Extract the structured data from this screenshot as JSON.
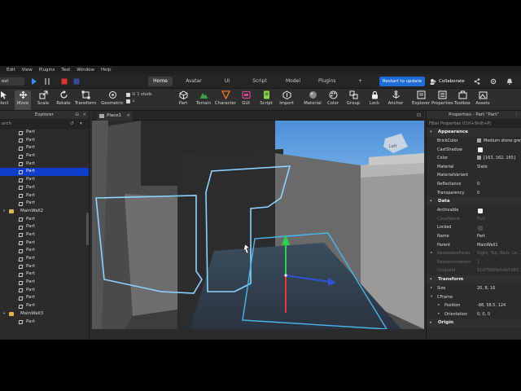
{
  "menu": [
    "Edit",
    "View",
    "Plugins",
    "Test",
    "Window",
    "Help"
  ],
  "test_mode": "est",
  "ribbon_tabs": [
    {
      "label": "Home",
      "active": true
    },
    {
      "label": "Avatar",
      "active": false
    },
    {
      "label": "UI",
      "active": false
    },
    {
      "label": "Script",
      "active": false
    },
    {
      "label": "Model",
      "active": false
    },
    {
      "label": "Plugins",
      "active": false
    },
    {
      "label": "+",
      "active": false
    }
  ],
  "restart_label": "Restart to update",
  "collaborate_label": "Collaborate",
  "toolbar": {
    "tools": [
      "elect",
      "Move",
      "Scale",
      "Rotate",
      "Transform"
    ],
    "geometric": "Geometric",
    "snap_studs": "1 studs",
    "snap_angle": "",
    "create": [
      "Part",
      "Terrain",
      "Character",
      "GUI",
      "Script",
      "Import"
    ],
    "format": [
      "Material",
      "Color",
      "Group",
      "Lock",
      "Anchor"
    ],
    "windows": [
      "Explorer",
      "Properties",
      "Toolbox",
      "Assets"
    ]
  },
  "explorer": {
    "title": "Explorer",
    "search_placeholder": "arch",
    "rows": [
      {
        "label": "Part",
        "type": "part",
        "indent": 1
      },
      {
        "label": "Part",
        "type": "part",
        "indent": 1
      },
      {
        "label": "Part",
        "type": "part",
        "indent": 1
      },
      {
        "label": "Part",
        "type": "part",
        "indent": 1
      },
      {
        "label": "Part",
        "type": "part",
        "indent": 1
      },
      {
        "label": "Part",
        "type": "part",
        "indent": 1,
        "selected": true
      },
      {
        "label": "Part",
        "type": "part",
        "indent": 1
      },
      {
        "label": "Part",
        "type": "part",
        "indent": 1
      },
      {
        "label": "Part",
        "type": "part",
        "indent": 1
      },
      {
        "label": "Part",
        "type": "part",
        "indent": 1
      },
      {
        "label": "MainWall2",
        "type": "folder",
        "indent": 0
      },
      {
        "label": "Part",
        "type": "part",
        "indent": 1
      },
      {
        "label": "Part",
        "type": "part",
        "indent": 1
      },
      {
        "label": "Part",
        "type": "part",
        "indent": 1
      },
      {
        "label": "Part",
        "type": "part",
        "indent": 1
      },
      {
        "label": "Part",
        "type": "part",
        "indent": 1
      },
      {
        "label": "Part",
        "type": "part",
        "indent": 1
      },
      {
        "label": "Part",
        "type": "part",
        "indent": 1
      },
      {
        "label": "Part",
        "type": "part",
        "indent": 1
      },
      {
        "label": "Part",
        "type": "part",
        "indent": 1
      },
      {
        "label": "Part",
        "type": "part",
        "indent": 1
      },
      {
        "label": "Part",
        "type": "part",
        "indent": 1
      },
      {
        "label": "Part",
        "type": "part",
        "indent": 1
      },
      {
        "label": "MainWall3",
        "type": "folder",
        "indent": 0
      },
      {
        "label": "Part",
        "type": "part",
        "indent": 1
      }
    ]
  },
  "viewport": {
    "tab_label": "Place1",
    "viewcube_label": "Left"
  },
  "properties": {
    "title": "Properties - Part \"Part\"",
    "filter_placeholder": "Filter Properties (Ctrl+Shift+P)",
    "sections": [
      {
        "name": "Appearance",
        "rows": [
          {
            "name": "BrickColor",
            "value": "Medium stone grey",
            "swatch": "#a3a2a5"
          },
          {
            "name": "CastShadow",
            "check": true
          },
          {
            "name": "Color",
            "value": "[163, 162, 165]",
            "swatch": "#a3a2a5"
          },
          {
            "name": "Material",
            "value": "Slate"
          },
          {
            "name": "MaterialVariant",
            "value": ""
          },
          {
            "name": "Reflectance",
            "value": "0"
          },
          {
            "name": "Transparency",
            "value": "0"
          }
        ]
      },
      {
        "name": "Data",
        "rows": [
          {
            "name": "Archivable",
            "check": true
          },
          {
            "name": "ClassName",
            "value": "Part",
            "dim": true
          },
          {
            "name": "Locked",
            "check": false
          },
          {
            "name": "Name",
            "value": "Part"
          },
          {
            "name": "Parent",
            "value": "MainWall1"
          },
          {
            "name": "ResizeableFaces",
            "value": "Right, Top, Back, Le...",
            "dim": true,
            "caret": true
          },
          {
            "name": "ResizeIncrement",
            "value": "1",
            "dim": true
          },
          {
            "name": "UniqueId",
            "value": "61d7586fe0afe5d80...",
            "dim": true
          }
        ]
      },
      {
        "name": "Transform",
        "rows": [
          {
            "name": "Size",
            "value": "20, 8, 16",
            "caret": true
          },
          {
            "name": "CFrame",
            "value": "",
            "caret": true,
            "open": true
          },
          {
            "name": "Position",
            "value": "-98, 58.5, 124",
            "caret": true,
            "sub": true
          },
          {
            "name": "Orientation",
            "value": "0, 0, 0",
            "caret": true,
            "sub": true
          }
        ]
      },
      {
        "name": "Origin",
        "rows": []
      }
    ]
  },
  "colors": {
    "accent": "#1e6cd6",
    "selection": "#0f3cc9",
    "outline": "#8fd3ff"
  }
}
